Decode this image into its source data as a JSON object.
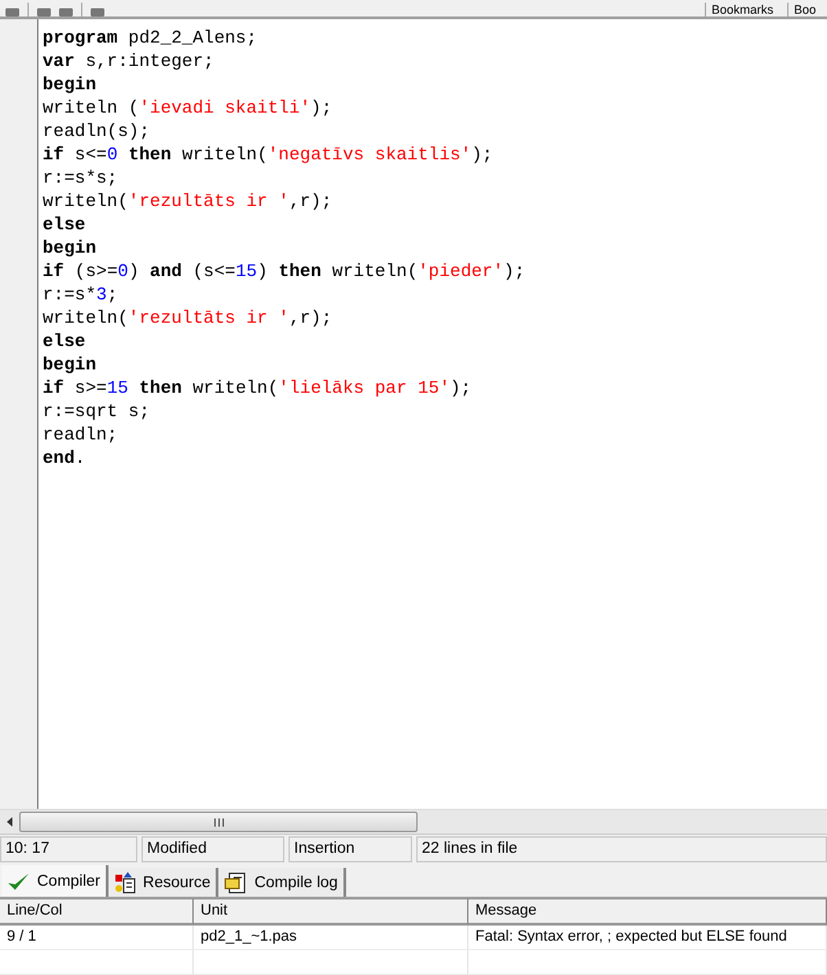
{
  "toolbar": {
    "items": [
      "Bookmarks",
      "Boo"
    ]
  },
  "editor": {
    "lines": [
      [
        {
          "kind": "keyword",
          "text": "program"
        },
        {
          "kind": "plain",
          "text": " pd2_2_Alens;"
        }
      ],
      [
        {
          "kind": "keyword",
          "text": "var"
        },
        {
          "kind": "plain",
          "text": " s,r:integer;"
        }
      ],
      [
        {
          "kind": "keyword",
          "text": "begin"
        }
      ],
      [
        {
          "kind": "plain",
          "text": "writeln ("
        },
        {
          "kind": "string",
          "text": "'ievadi skaitli'"
        },
        {
          "kind": "plain",
          "text": ");"
        }
      ],
      [
        {
          "kind": "plain",
          "text": "readln(s);"
        }
      ],
      [
        {
          "kind": "keyword",
          "text": "if"
        },
        {
          "kind": "plain",
          "text": " s<="
        },
        {
          "kind": "number",
          "text": "0"
        },
        {
          "kind": "keyword",
          "text": " then"
        },
        {
          "kind": "plain",
          "text": " writeln("
        },
        {
          "kind": "string",
          "text": "'negatīvs skaitlis'"
        },
        {
          "kind": "plain",
          "text": ");"
        }
      ],
      [
        {
          "kind": "plain",
          "text": "r:=s*s;"
        }
      ],
      [
        {
          "kind": "plain",
          "text": "writeln("
        },
        {
          "kind": "string",
          "text": "'rezultāts ir '"
        },
        {
          "kind": "plain",
          "text": ",r);"
        }
      ],
      [
        {
          "kind": "keyword",
          "text": "else"
        }
      ],
      [
        {
          "kind": "keyword",
          "text": "begin"
        }
      ],
      [
        {
          "kind": "keyword",
          "text": "if"
        },
        {
          "kind": "plain",
          "text": " (s>="
        },
        {
          "kind": "number",
          "text": "0"
        },
        {
          "kind": "plain",
          "text": ") "
        },
        {
          "kind": "keyword",
          "text": "and"
        },
        {
          "kind": "plain",
          "text": " (s<="
        },
        {
          "kind": "number",
          "text": "15"
        },
        {
          "kind": "plain",
          "text": ") "
        },
        {
          "kind": "keyword",
          "text": "then"
        },
        {
          "kind": "plain",
          "text": " writeln("
        },
        {
          "kind": "string",
          "text": "'pieder'"
        },
        {
          "kind": "plain",
          "text": ");"
        }
      ],
      [
        {
          "kind": "plain",
          "text": "r:=s*"
        },
        {
          "kind": "number",
          "text": "3"
        },
        {
          "kind": "plain",
          "text": ";"
        }
      ],
      [
        {
          "kind": "plain",
          "text": "writeln("
        },
        {
          "kind": "string",
          "text": "'rezultāts ir '"
        },
        {
          "kind": "plain",
          "text": ",r);"
        }
      ],
      [
        {
          "kind": "keyword",
          "text": "else"
        }
      ],
      [
        {
          "kind": "keyword",
          "text": "begin"
        }
      ],
      [
        {
          "kind": "keyword",
          "text": "if"
        },
        {
          "kind": "plain",
          "text": " s>="
        },
        {
          "kind": "number",
          "text": "15"
        },
        {
          "kind": "keyword",
          "text": " then"
        },
        {
          "kind": "plain",
          "text": " writeln("
        },
        {
          "kind": "string",
          "text": "'lielāks par 15'"
        },
        {
          "kind": "plain",
          "text": ");"
        }
      ],
      [
        {
          "kind": "plain",
          "text": "r:=sqrt s;"
        }
      ],
      [
        {
          "kind": "plain",
          "text": "readln;"
        }
      ],
      [
        {
          "kind": "keyword",
          "text": "end"
        },
        {
          "kind": "plain",
          "text": "."
        }
      ]
    ]
  },
  "status_bar": [
    "10: 17",
    "Modified",
    "Insertion",
    "22 lines in file"
  ],
  "tabs": [
    {
      "label": "Compiler",
      "kind": "check",
      "selected": true
    },
    {
      "label": "Resource",
      "kind": "resource",
      "selected": false
    },
    {
      "label": "Compile log",
      "kind": "log",
      "selected": false
    }
  ],
  "messages": {
    "columns": [
      "Line/Col",
      "Unit",
      "Message"
    ],
    "rows": [
      [
        "9 / 1",
        "pd2_1_~1.pas",
        "Fatal: Syntax error, ; expected but ELSE found"
      ]
    ]
  }
}
